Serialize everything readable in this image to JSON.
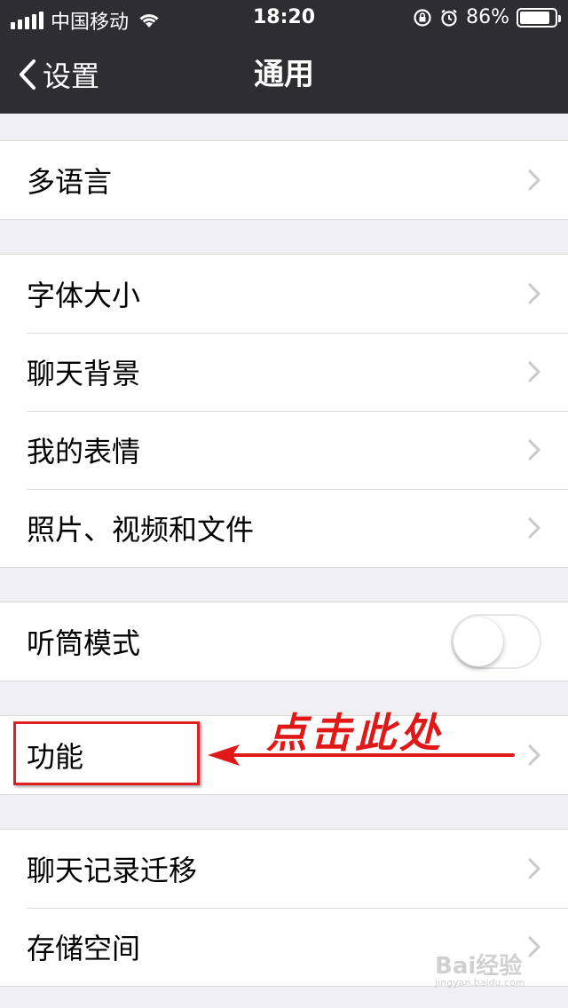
{
  "status_bar": {
    "carrier": "中国移动",
    "time": "18:20",
    "battery": "86%",
    "battery_level": 0.86
  },
  "nav": {
    "back_label": "设置",
    "title": "通用"
  },
  "groups": {
    "g1": [
      "多语言"
    ],
    "g2": [
      "字体大小",
      "聊天背景",
      "我的表情",
      "照片、视频和文件"
    ],
    "g3": [
      "听筒模式"
    ],
    "g4": [
      "功能"
    ],
    "g5": [
      "聊天记录迁移",
      "存储空间"
    ]
  },
  "toggle_receiver_mode": false,
  "annotation": {
    "text": "点击此处",
    "color": "#e01818"
  },
  "watermark": {
    "brand": "Bai经验",
    "sub": "jingyan.baidu.com"
  },
  "colors": {
    "bar_bg": "#2e2e32",
    "page_bg": "#efeff4",
    "accent_red": "#e02020"
  },
  "icons": {
    "back": "chevron-left-icon",
    "disclosure": "chevron-right-icon",
    "wifi": "wifi-icon",
    "rotation_lock": "rotation-lock-icon",
    "alarm": "alarm-icon",
    "battery": "battery-icon",
    "arrow": "arrow-left-icon"
  }
}
